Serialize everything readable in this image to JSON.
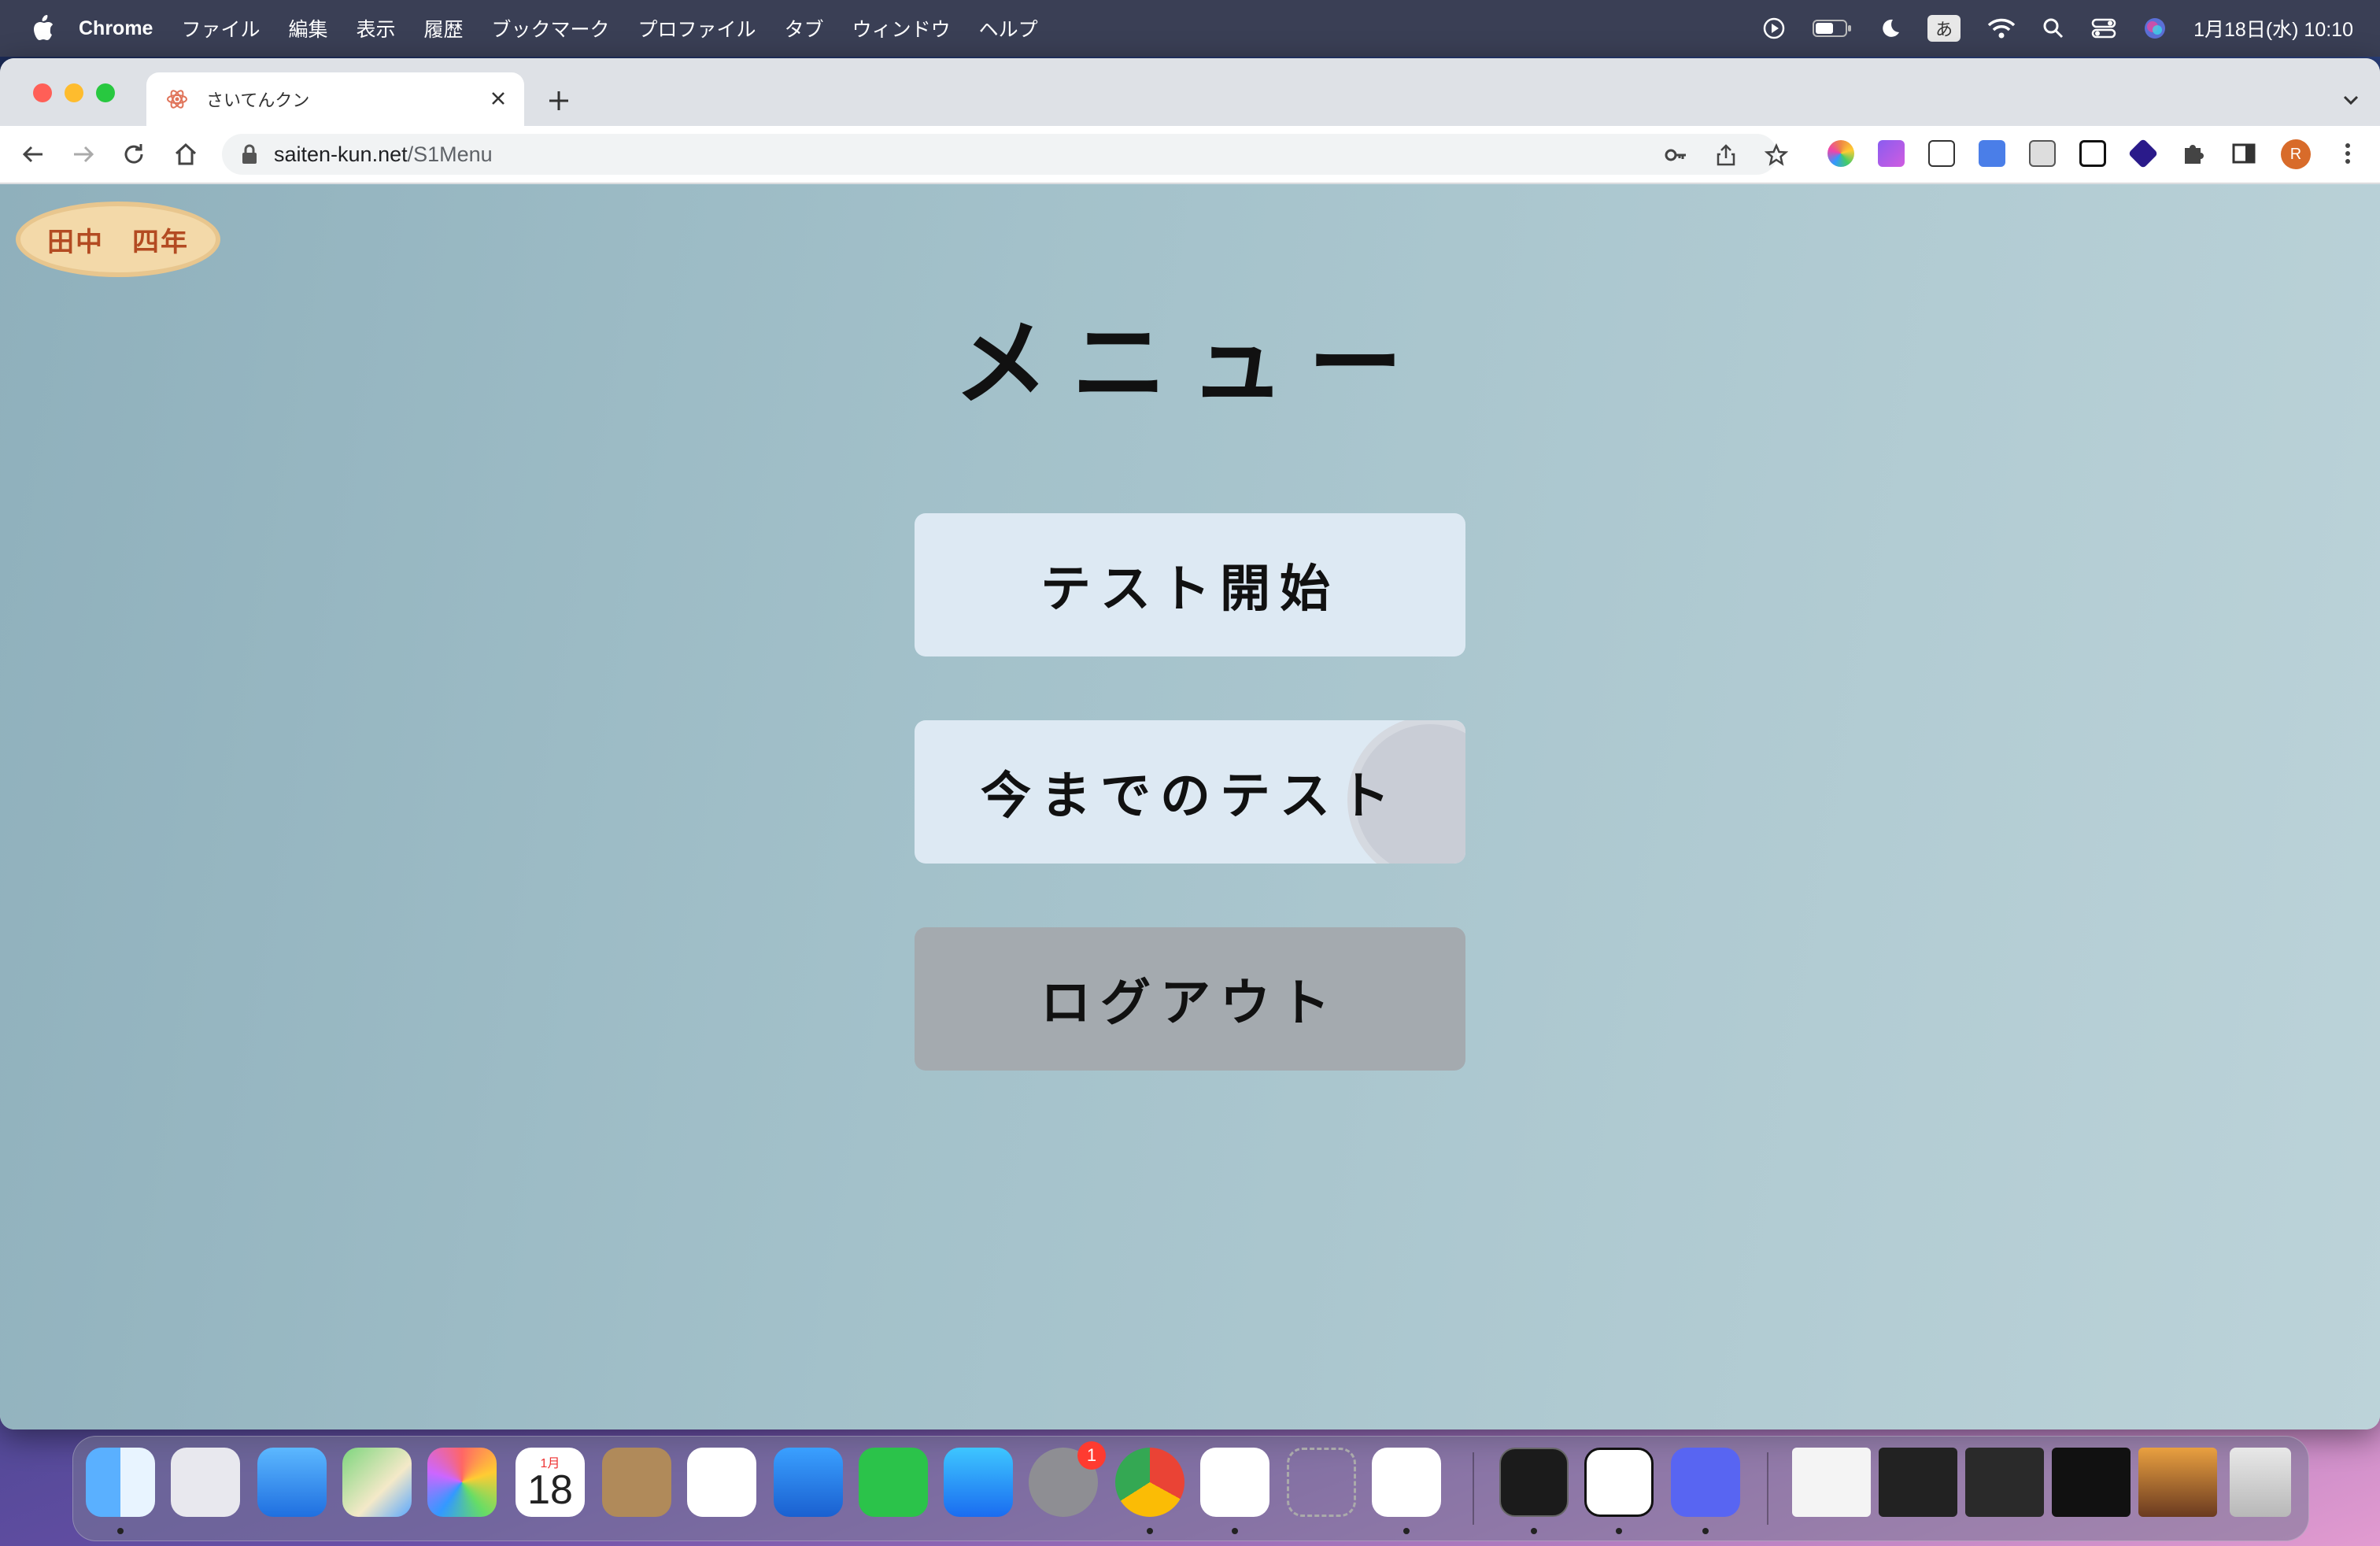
{
  "menubar": {
    "app_name": "Chrome",
    "items": [
      "ファイル",
      "編集",
      "表示",
      "履歴",
      "ブックマーク",
      "プロファイル",
      "タブ",
      "ウィンドウ",
      "ヘルプ"
    ],
    "ime": "あ",
    "clock": "1月18日(水) 10:10"
  },
  "browser": {
    "tab_title": "さいてんクン",
    "url_host": "saiten-kun.net",
    "url_path": "/S1Menu",
    "profile_initial": "R"
  },
  "page": {
    "user_badge": "田中　四年",
    "title": "メニュー",
    "buttons": {
      "start": "テスト開始",
      "history": "今までのテスト",
      "logout": "ログアウト"
    }
  },
  "dock": {
    "calendar_month": "1月",
    "calendar_day": "18",
    "settings_badge": "1",
    "apps": [
      "finder-icon",
      "launchpad-icon",
      "mail-icon",
      "maps-icon",
      "photos-icon",
      "calendar-icon",
      "contacts-icon",
      "reminders-icon",
      "keynote-icon",
      "numbers-icon",
      "app-store-icon",
      "system-settings-icon",
      "chrome-icon",
      "slack-icon",
      "unknown-app-icon",
      "vscode-icon",
      "terminal-icon",
      "notion-icon",
      "discord-icon"
    ]
  },
  "colors": {
    "page_bg": "#a3c1ca",
    "button_bg": "#dde9f3",
    "logout_bg": "#a4aaaf",
    "badge_text": "#b34b22"
  }
}
